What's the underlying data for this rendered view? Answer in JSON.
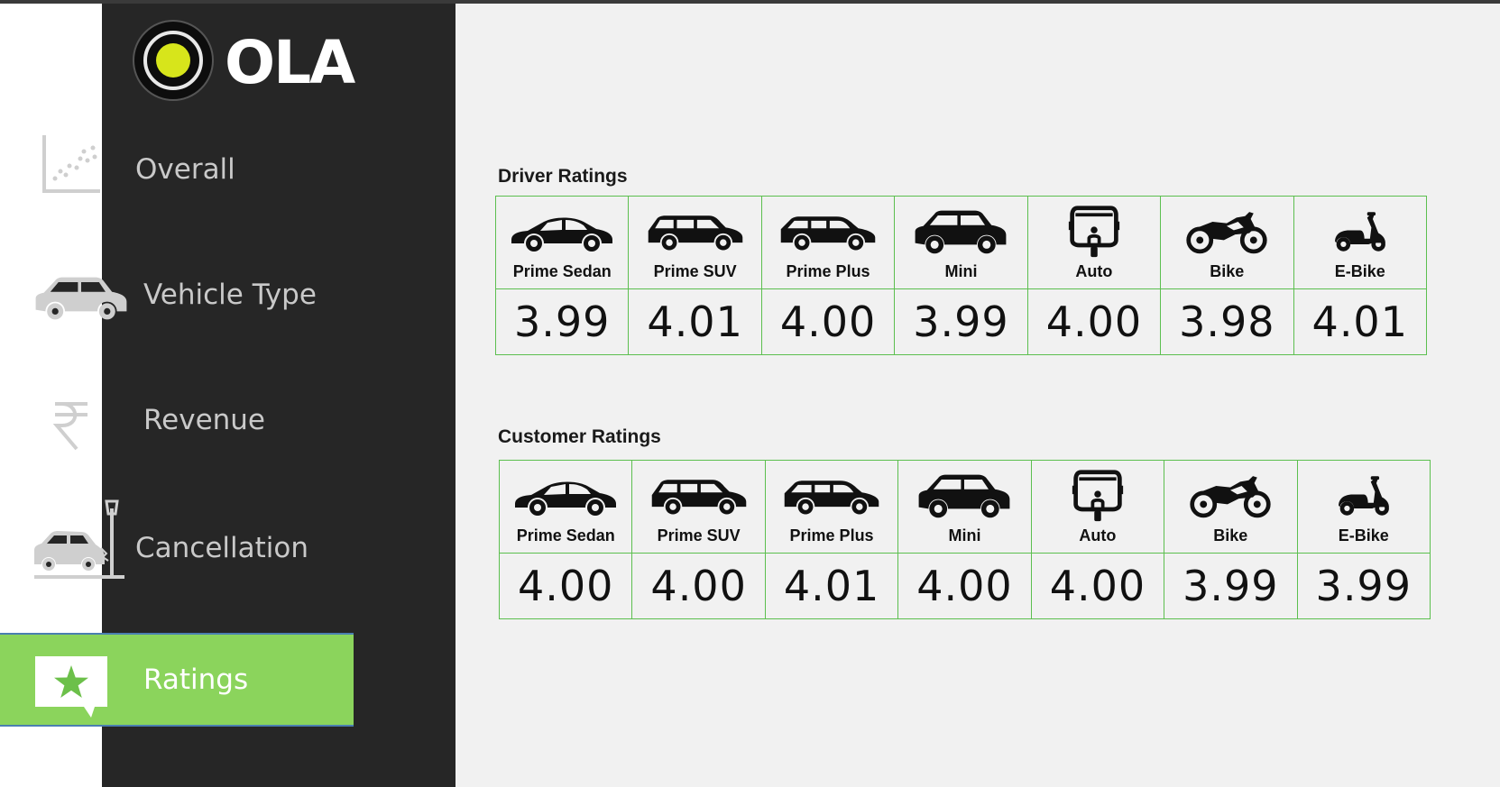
{
  "logo": {
    "text": "OLA",
    "dot_color": "#d7e51b"
  },
  "sidebar": {
    "items": [
      {
        "label": "Overall",
        "icon": "scatter-chart-icon",
        "active": false
      },
      {
        "label": "Vehicle Type",
        "icon": "car-icon",
        "active": false
      },
      {
        "label": "Revenue",
        "icon": "rupee-icon",
        "active": false
      },
      {
        "label": "Cancellation",
        "icon": "car-crash-icon",
        "active": false
      },
      {
        "label": "Ratings",
        "icon": "star-message-icon",
        "active": true
      }
    ],
    "active_color": "#8bd45c"
  },
  "driver_ratings": {
    "title": "Driver Ratings",
    "vehicles": [
      "Prime Sedan",
      "Prime SUV",
      "Prime Plus",
      "Mini",
      "Auto",
      "Bike",
      "E-Bike"
    ],
    "values": [
      "3.99",
      "4.01",
      "4.00",
      "3.99",
      "4.00",
      "3.98",
      "4.01"
    ]
  },
  "customer_ratings": {
    "title": "Customer Ratings",
    "vehicles": [
      "Prime Sedan",
      "Prime SUV",
      "Prime Plus",
      "Mini",
      "Auto",
      "Bike",
      "E-Bike"
    ],
    "values": [
      "4.00",
      "4.00",
      "4.01",
      "4.00",
      "4.00",
      "3.99",
      "3.99"
    ]
  },
  "vehicle_icons": [
    "sedan-icon",
    "suv-icon",
    "hatchback-icon",
    "mini-car-icon",
    "auto-rickshaw-icon",
    "motorbike-icon",
    "scooter-icon"
  ],
  "table_border_color": "#5cbf4f"
}
